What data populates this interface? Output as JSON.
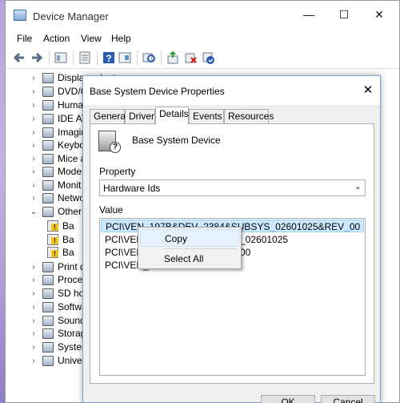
{
  "window": {
    "title": "Device Manager",
    "controls": {
      "minimize": "—",
      "maximize": "☐",
      "close": "✕"
    }
  },
  "menu": [
    "File",
    "Action",
    "View",
    "Help"
  ],
  "toolbar": {
    "icons": [
      "back-icon",
      "forward-icon",
      "properties-icon",
      "details-icon",
      "help-icon",
      "show-hidden-icon",
      "scan-icon",
      "update-driver-icon",
      "uninstall-icon",
      "enable-device-icon"
    ]
  },
  "tree": {
    "items": [
      {
        "label": "Display adapters",
        "chevron": "›"
      },
      {
        "label": "DVD/C",
        "chevron": "›"
      },
      {
        "label": "Huma",
        "chevron": "›"
      },
      {
        "label": "IDE AT",
        "chevron": "›"
      },
      {
        "label": "Imagin",
        "chevron": "›"
      },
      {
        "label": "Keybo",
        "chevron": "›"
      },
      {
        "label": "Mice a",
        "chevron": "›"
      },
      {
        "label": "Mode",
        "chevron": "›"
      },
      {
        "label": "Monit",
        "chevron": "›"
      },
      {
        "label": "Netwo",
        "chevron": "›"
      },
      {
        "label": "Other",
        "chevron": "⌄"
      },
      {
        "label": "Ba",
        "chevron": ""
      },
      {
        "label": "Ba",
        "chevron": ""
      },
      {
        "label": "Ba",
        "chevron": ""
      },
      {
        "label": "Print q",
        "chevron": "›"
      },
      {
        "label": "Proces",
        "chevron": "›"
      },
      {
        "label": "SD ho",
        "chevron": "›"
      },
      {
        "label": "Softwa",
        "chevron": "›"
      },
      {
        "label": "Sound",
        "chevron": "›"
      },
      {
        "label": "Storag",
        "chevron": "›"
      },
      {
        "label": "System",
        "chevron": "›"
      },
      {
        "label": "Univer",
        "chevron": "›"
      }
    ]
  },
  "dialog": {
    "title": "Base System Device Properties",
    "close": "✕",
    "tabs": [
      "General",
      "Driver",
      "Details",
      "Events",
      "Resources"
    ],
    "active_tab": "Details",
    "device_name": "Base System Device",
    "device_icon_badge": "?",
    "property_label": "Property",
    "property_value": "Hardware Ids",
    "property_arrow": "⌄",
    "value_label": "Value",
    "values": [
      "PCI\\VEN_197B&DEV_2384&SUBSYS_02601025&REV_00",
      "PCI\\VEN_",
      "PCI\\VEN_",
      "PCI\\VEN_"
    ],
    "values_right": [
      "",
      "_02601025",
      "00",
      ""
    ],
    "buttons": {
      "ok": "OK",
      "cancel": "Cancel"
    }
  },
  "context_menu": {
    "items": [
      "Copy",
      "Select All"
    ]
  }
}
